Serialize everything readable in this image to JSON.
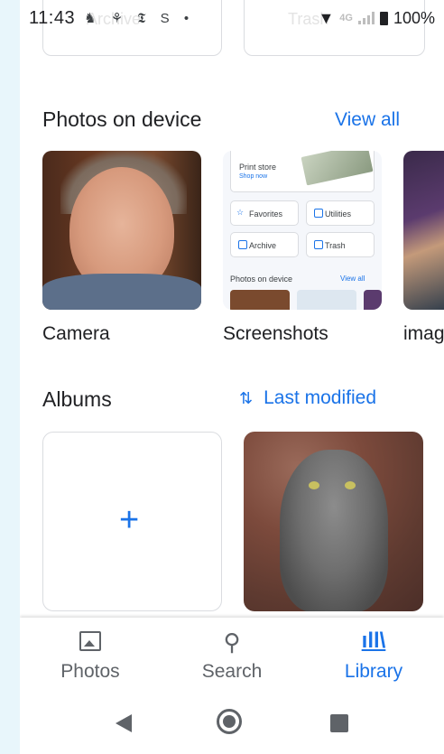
{
  "status_bar": {
    "time": "11:43",
    "notifications": "♞ ⚘ 𝕿 S •",
    "network": "4G",
    "battery": "100%"
  },
  "top_cards": [
    "Archive",
    "Trash"
  ],
  "device_section": {
    "title": "Photos on device",
    "view_all": "View all",
    "folders": [
      {
        "label": "Camera"
      },
      {
        "label": "Screenshots"
      },
      {
        "label": "imag"
      }
    ]
  },
  "screenshot_preview": {
    "print_store": "Print store",
    "shop_now": "Shop now",
    "favorites": "Favorites",
    "utilities": "Utilities",
    "archive": "Archive",
    "trash": "Trash",
    "section": "Photos on device",
    "view_all": "View all"
  },
  "albums": {
    "title": "Albums",
    "sort_label": "Last modified",
    "new_album_symbol": "+"
  },
  "bottom_nav": {
    "items": [
      {
        "label": "Photos",
        "icon": "photo-icon",
        "active": false
      },
      {
        "label": "Search",
        "icon": "search-icon",
        "active": false
      },
      {
        "label": "Library",
        "icon": "library-icon",
        "active": true
      }
    ]
  },
  "colors": {
    "accent": "#1a73e8",
    "text": "#202124",
    "icon": "#5f6368"
  }
}
